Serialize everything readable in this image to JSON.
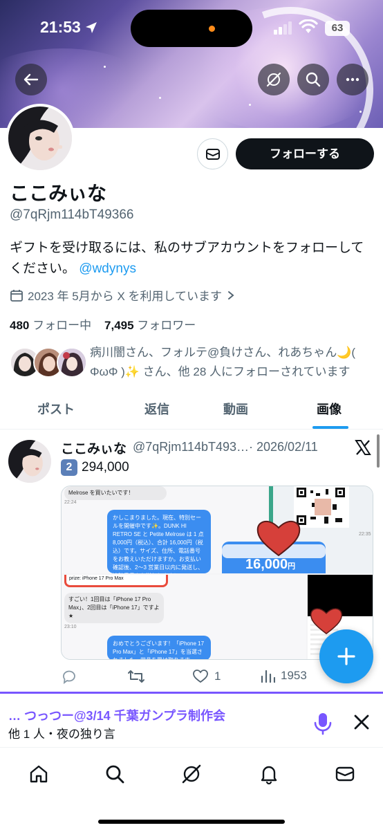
{
  "status_bar": {
    "time": "21:53",
    "battery": "63"
  },
  "profile": {
    "name": "ここみぃな",
    "handle": "@7qRjm114bT49366",
    "bio_text": "ギフトを受け取るには、私のサブアカウントをフォローしてください。",
    "bio_mention": "@wdynys",
    "joined": "2023 年 5月から X を利用しています",
    "following_count": "480",
    "following_label": "フォロー中",
    "followers_count": "7,495",
    "followers_label": "フォロワー",
    "followed_by": "病川闇さん、フォルテ@負けさん、れあちゃん🌙( ΦωΦ )✨ さん、他 28 人にフォローされています",
    "follow_button": "フォローする"
  },
  "tabs": [
    {
      "label": "ポスト",
      "active": false
    },
    {
      "label": "返信",
      "active": false
    },
    {
      "label": "動画",
      "active": false
    },
    {
      "label": "画像",
      "active": true
    }
  ],
  "post": {
    "author_name": "ここみぃな",
    "meta": "@7qRjm114bT493…· 2026/02/11",
    "keycap": "2",
    "text": "294,000",
    "media": {
      "msg1": "Melrose を買いたいです！",
      "ts1": "22:24",
      "msg2": "かしこまりました。現在、特別セールを開催中です✨。DUNK HI RETRO SE と Petite Melrose は 1 点 8,000円（税込）、合計 16,000円（税込）です。サイズ、住所、電話番号をお教えいただけますか。お支払い確認後、2〜3 営業日以内に発送し、追跡番号をお送りします！",
      "price": "16,000",
      "price_unit": "円",
      "ts2": "22:35",
      "prize_header": "prize: iPhone 17 Pro Max",
      "msg3": "すごい！1回目は「iPhone 17 Pro Max」、2回目は「iPhone 17」ですよ★",
      "ts3": "23:10",
      "msg4": "おめでとうございます！「iPhone 17 Pro Max」と「iPhone 17」を当選されました。賞品を受け取ります"
    },
    "likes": "1",
    "views": "1953"
  },
  "spaces": {
    "title": "… つっつー@3/14 千葉ガンプラ制作会",
    "subtitle": "他 1 人・夜の独り言"
  },
  "colors": {
    "accent": "#1d9bf0",
    "spaces": "#7856ff",
    "text": "#0f1419",
    "muted": "#536471"
  }
}
